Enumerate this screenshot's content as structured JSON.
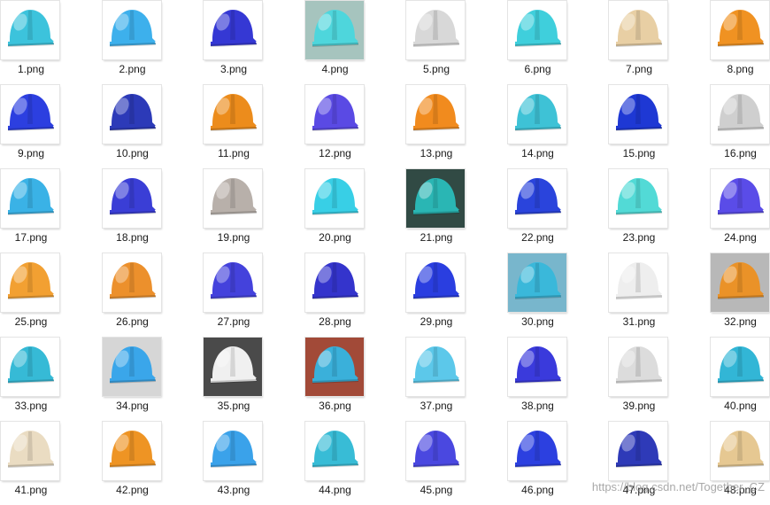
{
  "files": [
    {
      "name": "1.png",
      "color": "#3cc3dc",
      "bg": "#ffffff",
      "icon": "helmet-icon"
    },
    {
      "name": "2.png",
      "color": "#3db0ec",
      "bg": "#ffffff",
      "icon": "helmet-icon"
    },
    {
      "name": "3.png",
      "color": "#3538d4",
      "bg": "#ffffff",
      "icon": "helmet-icon"
    },
    {
      "name": "4.png",
      "color": "#4ed6dc",
      "bg": "#a6c4be",
      "icon": "helmet-icon"
    },
    {
      "name": "5.png",
      "color": "#d8d8d8",
      "bg": "#ffffff",
      "icon": "helmet-icon"
    },
    {
      "name": "6.png",
      "color": "#3fcfdc",
      "bg": "#ffffff",
      "icon": "helmet-icon"
    },
    {
      "name": "7.png",
      "color": "#e8cfa4",
      "bg": "#ffffff",
      "icon": "helmet-icon"
    },
    {
      "name": "8.png",
      "color": "#f09222",
      "bg": "#ffffff",
      "icon": "helmet-icon"
    },
    {
      "name": "9.png",
      "color": "#2c3fe0",
      "bg": "#ffffff",
      "icon": "helmet-icon"
    },
    {
      "name": "10.png",
      "color": "#2c3ab8",
      "bg": "#ffffff",
      "icon": "helmet-icon"
    },
    {
      "name": "11.png",
      "color": "#ec8c1c",
      "bg": "#ffffff",
      "icon": "helmet-icon"
    },
    {
      "name": "12.png",
      "color": "#5a4ae4",
      "bg": "#ffffff",
      "icon": "helmet-icon"
    },
    {
      "name": "13.png",
      "color": "#f18b1e",
      "bg": "#ffffff",
      "icon": "helmet-icon"
    },
    {
      "name": "14.png",
      "color": "#3ec2d6",
      "bg": "#ffffff",
      "icon": "helmet-icon"
    },
    {
      "name": "15.png",
      "color": "#1e38d4",
      "bg": "#ffffff",
      "icon": "helmet-icon"
    },
    {
      "name": "16.png",
      "color": "#cfcfcf",
      "bg": "#ffffff",
      "icon": "helmet-icon"
    },
    {
      "name": "17.png",
      "color": "#3ab2e6",
      "bg": "#ffffff",
      "icon": "helmet-icon"
    },
    {
      "name": "18.png",
      "color": "#3a3ed6",
      "bg": "#ffffff",
      "icon": "helmet-icon"
    },
    {
      "name": "19.png",
      "color": "#b8b0aa",
      "bg": "#ffffff",
      "icon": "helmet-icon"
    },
    {
      "name": "20.png",
      "color": "#38cfe6",
      "bg": "#ffffff",
      "icon": "helmet-icon"
    },
    {
      "name": "21.png",
      "color": "#2ab6b4",
      "bg": "#314a44",
      "icon": "helmet-icon"
    },
    {
      "name": "22.png",
      "color": "#2a44dc",
      "bg": "#ffffff",
      "icon": "helmet-icon"
    },
    {
      "name": "23.png",
      "color": "#52dad6",
      "bg": "#ffffff",
      "icon": "helmet-icon"
    },
    {
      "name": "24.png",
      "color": "#5a4ce8",
      "bg": "#ffffff",
      "icon": "helmet-icon"
    },
    {
      "name": "25.png",
      "color": "#f2a032",
      "bg": "#ffffff",
      "icon": "helmet-icon"
    },
    {
      "name": "26.png",
      "color": "#ec902c",
      "bg": "#ffffff",
      "icon": "helmet-icon"
    },
    {
      "name": "27.png",
      "color": "#4442dc",
      "bg": "#ffffff",
      "icon": "helmet-icon"
    },
    {
      "name": "28.png",
      "color": "#3434cc",
      "bg": "#ffffff",
      "icon": "helmet-icon"
    },
    {
      "name": "29.png",
      "color": "#2a3ee0",
      "bg": "#ffffff",
      "icon": "helmet-icon"
    },
    {
      "name": "30.png",
      "color": "#3ab8da",
      "bg": "#78b6cc",
      "icon": "helmet-icon"
    },
    {
      "name": "31.png",
      "color": "#eeeeee",
      "bg": "#ffffff",
      "icon": "helmet-icon"
    },
    {
      "name": "32.png",
      "color": "#ea9228",
      "bg": "#b8b8b8",
      "icon": "helmet-icon"
    },
    {
      "name": "33.png",
      "color": "#36bad6",
      "bg": "#ffffff",
      "icon": "helmet-icon"
    },
    {
      "name": "34.png",
      "color": "#3aa6ea",
      "bg": "#d6d6d6",
      "icon": "helmet-icon"
    },
    {
      "name": "35.png",
      "color": "#f0f0f0",
      "bg": "#4a4a4a",
      "icon": "helmet-icon"
    },
    {
      "name": "36.png",
      "color": "#3ab0da",
      "bg": "#a24a38",
      "icon": "helmet-icon"
    },
    {
      "name": "37.png",
      "color": "#5cc8ea",
      "bg": "#ffffff",
      "icon": "helmet-icon"
    },
    {
      "name": "38.png",
      "color": "#3a3adc",
      "bg": "#ffffff",
      "icon": "helmet-icon"
    },
    {
      "name": "39.png",
      "color": "#dcdcdc",
      "bg": "#ffffff",
      "icon": "helmet-icon"
    },
    {
      "name": "40.png",
      "color": "#32b6d6",
      "bg": "#ffffff",
      "icon": "helmet-icon"
    },
    {
      "name": "41.png",
      "color": "#eadcc2",
      "bg": "#ffffff",
      "icon": "helmet-icon"
    },
    {
      "name": "42.png",
      "color": "#ee9424",
      "bg": "#ffffff",
      "icon": "helmet-icon"
    },
    {
      "name": "43.png",
      "color": "#3aa2ea",
      "bg": "#ffffff",
      "icon": "helmet-icon"
    },
    {
      "name": "44.png",
      "color": "#38bcd6",
      "bg": "#ffffff",
      "icon": "helmet-icon"
    },
    {
      "name": "45.png",
      "color": "#4a48e0",
      "bg": "#ffffff",
      "icon": "helmet-icon"
    },
    {
      "name": "46.png",
      "color": "#2c40e0",
      "bg": "#ffffff",
      "icon": "helmet-icon"
    },
    {
      "name": "47.png",
      "color": "#2e3ab8",
      "bg": "#ffffff",
      "icon": "helmet-icon"
    },
    {
      "name": "48.png",
      "color": "#e6c892",
      "bg": "#ffffff",
      "icon": "helmet-icon"
    }
  ],
  "watermark": "https://blog.csdn.net/Together_CZ"
}
